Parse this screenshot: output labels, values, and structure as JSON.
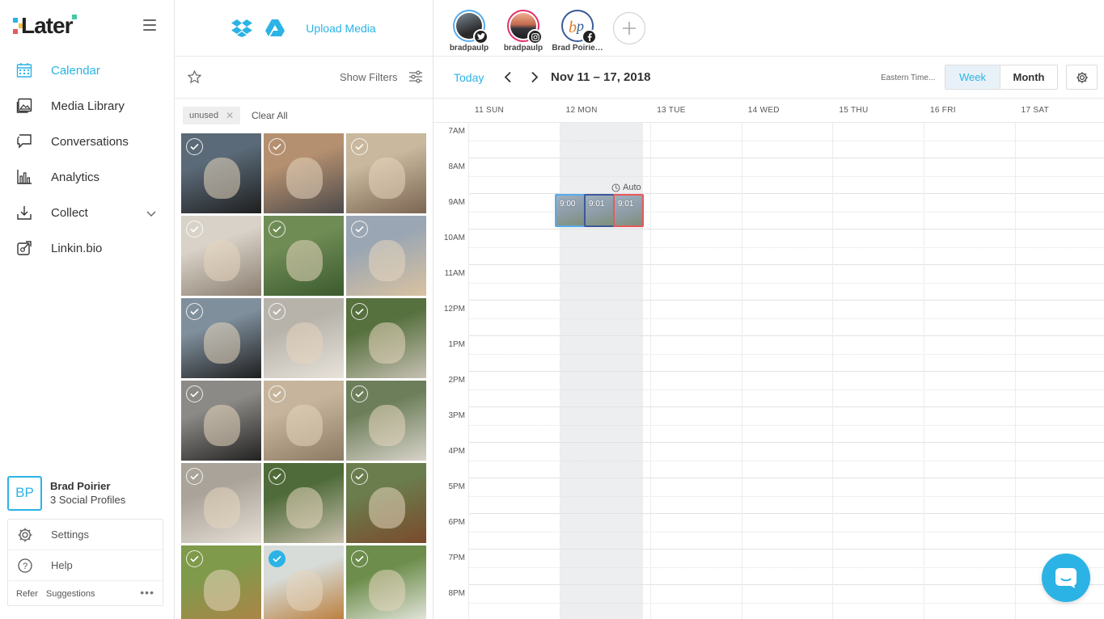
{
  "app": {
    "name": "Later",
    "accent": "#2bb3e5"
  },
  "sidebar": {
    "items": [
      {
        "label": "Calendar",
        "icon": "calendar-icon",
        "active": true
      },
      {
        "label": "Media Library",
        "icon": "image-icon"
      },
      {
        "label": "Conversations",
        "icon": "chat-bubble-icon"
      },
      {
        "label": "Analytics",
        "icon": "bar-chart-icon"
      },
      {
        "label": "Collect",
        "icon": "download-tray-icon"
      },
      {
        "label": "Linkin.bio",
        "icon": "link-icon"
      }
    ],
    "profile": {
      "initials": "BP",
      "name": "Brad Poirier",
      "subtitle": "3 Social Profiles"
    },
    "settings_label": "Settings",
    "help_label": "Help",
    "refer_label": "Refer",
    "suggestions_label": "Suggestions",
    "more_label": "•••"
  },
  "media": {
    "upload_label": "Upload Media",
    "show_filters_label": "Show Filters",
    "active_tag": "unused",
    "clear_all_label": "Clear All",
    "thumbs": [
      {
        "desc": "man-with-dog",
        "c1": "#5b6a78",
        "c2": "#1e1e1e"
      },
      {
        "desc": "chihuahua-bed",
        "c1": "#b59070",
        "c2": "#4d4a4a"
      },
      {
        "desc": "bedroom-dog",
        "c1": "#c9b89d",
        "c2": "#7b6652"
      },
      {
        "desc": "dog-fence",
        "c1": "#d9d2c8",
        "c2": "#8a7e70"
      },
      {
        "desc": "dog-grass",
        "c1": "#6f8c55",
        "c2": "#3b5a2e"
      },
      {
        "desc": "dog-bowtie",
        "c1": "#9aa6b3",
        "c2": "#d9c2a0"
      },
      {
        "desc": "man-holding-dog",
        "c1": "#7f8f9c",
        "c2": "#1f1f1f"
      },
      {
        "desc": "dog-closeup",
        "c1": "#b7b3ab",
        "c2": "#e8e2da"
      },
      {
        "desc": "dog-park",
        "c1": "#56703e",
        "c2": "#c6c0b2"
      },
      {
        "desc": "man-hug-dog",
        "c1": "#8c8a86",
        "c2": "#222"
      },
      {
        "desc": "dog-bed-pattern",
        "c1": "#c6b59c",
        "c2": "#8d7a64"
      },
      {
        "desc": "dog-sitting",
        "c1": "#6d7f5a",
        "c2": "#d8d3ca"
      },
      {
        "desc": "dog-looking-up",
        "c1": "#a9a39a",
        "c2": "#e5dfd6"
      },
      {
        "desc": "dog-grass-2",
        "c1": "#4f6b39",
        "c2": "#c9c0ae"
      },
      {
        "desc": "basset-hound",
        "c1": "#6b7d4d",
        "c2": "#7a4a2c"
      },
      {
        "desc": "dog-lying-lawn",
        "c1": "#7e9a4a",
        "c2": "#b08348"
      },
      {
        "desc": "boxer-dog",
        "c1": "#d7dcd9",
        "c2": "#b9772f",
        "selected": true
      },
      {
        "desc": "white-dog-leash",
        "c1": "#6c8d4b",
        "c2": "#ecebe6"
      }
    ]
  },
  "calendar": {
    "profiles": [
      {
        "name": "bradpaulp",
        "network": "twitter",
        "ring": "#55acee"
      },
      {
        "name": "bradpaulp",
        "network": "instagram",
        "ring": "#e1306c"
      },
      {
        "name": "Brad Poirie…",
        "network": "facebook",
        "ring": "#3b5998"
      }
    ],
    "today_label": "Today",
    "range_label": "Nov 11 – 17, 2018",
    "timezone_label": "Eastern Time...",
    "view_week": "Week",
    "view_month": "Month",
    "days": [
      "11 SUN",
      "12 MON",
      "13 TUE",
      "14 WED",
      "15 THU",
      "16 FRI",
      "17 SAT"
    ],
    "hours": [
      "7AM",
      "8AM",
      "9AM",
      "10AM",
      "11AM",
      "12PM",
      "1PM",
      "2PM",
      "3PM",
      "4PM",
      "5PM",
      "6PM",
      "7PM",
      "8PM"
    ],
    "auto_label": "Auto",
    "posts": [
      {
        "time": "9:00",
        "color": "#55acee"
      },
      {
        "time": "9:01",
        "color": "#3b5998"
      },
      {
        "time": "9:01",
        "color": "#e8595a"
      }
    ]
  }
}
